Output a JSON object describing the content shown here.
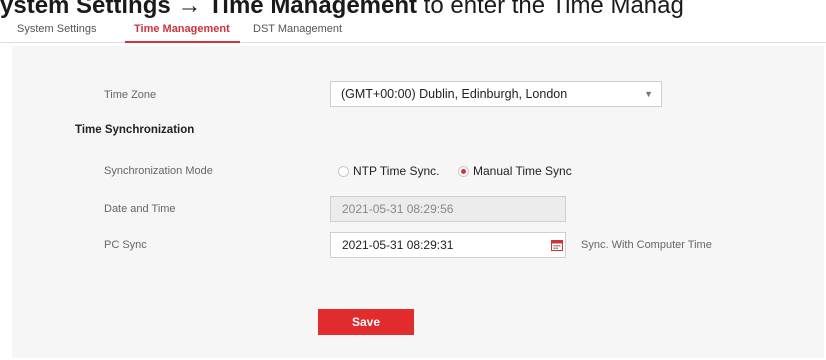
{
  "caption": {
    "prefix": "ystem Settings",
    "arrow": " → ",
    "highlight": "Time Management",
    "suffix": " to enter the Time Manag"
  },
  "tabs": [
    {
      "label": "System Settings",
      "active": false
    },
    {
      "label": "Time Management",
      "active": true
    },
    {
      "label": "DST Management",
      "active": false
    }
  ],
  "form": {
    "time_zone_label": "Time Zone",
    "time_zone_value": "(GMT+00:00) Dublin, Edinburgh, London",
    "time_sync_heading": "Time Synchronization",
    "sync_mode_label": "Synchronization Mode",
    "sync_options": [
      {
        "label": "NTP Time Sync.",
        "checked": false
      },
      {
        "label": "Manual Time Sync",
        "checked": true
      }
    ],
    "date_time_label": "Date and Time",
    "date_time_value": "2021-05-31 08:29:56",
    "pc_sync_label": "PC Sync",
    "pc_sync_value": "2021-05-31 08:29:31",
    "sync_computer_label": "Sync. With Computer Time"
  },
  "actions": {
    "save_label": "Save"
  },
  "colors": {
    "accent": "#d0333a",
    "save_button": "#e12b2d",
    "panel_bg": "#f6f6f6"
  },
  "icons": {
    "select_arrow": "chevron-down-icon",
    "calendar": "calendar-icon"
  }
}
